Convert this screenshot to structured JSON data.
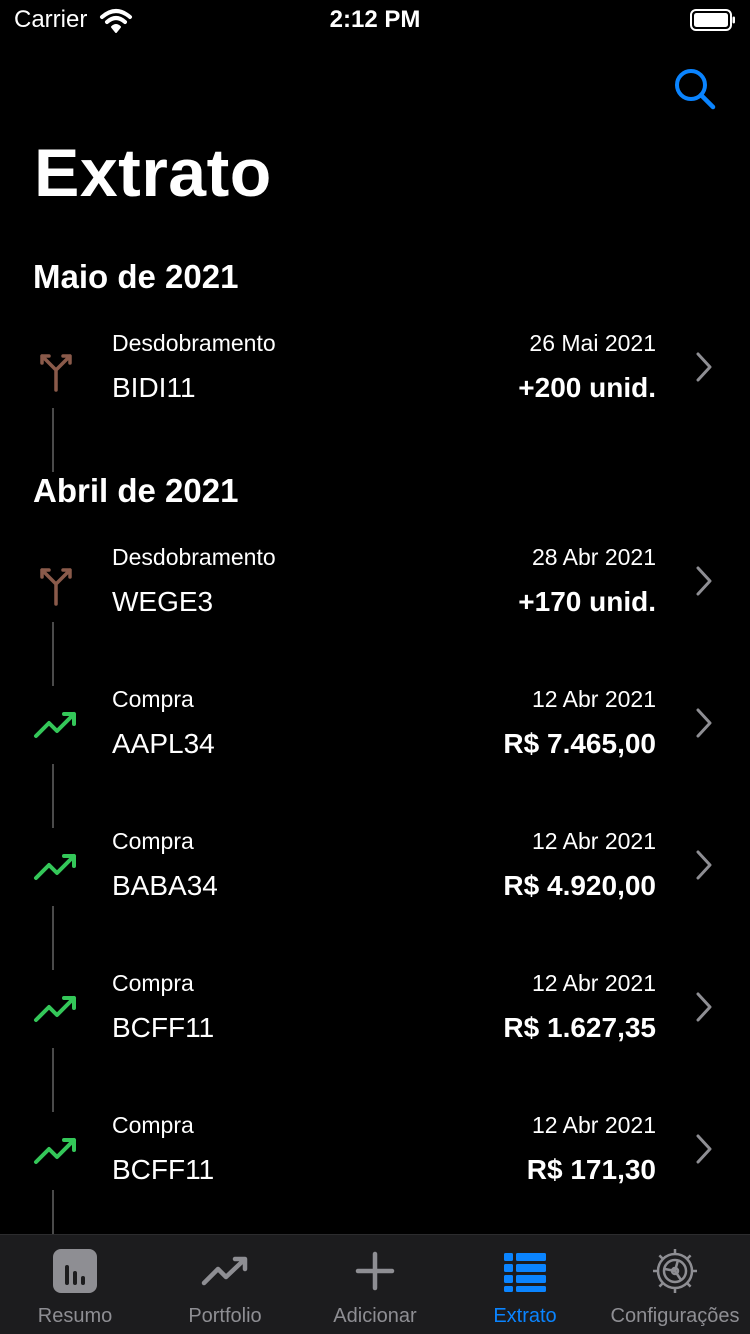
{
  "status_bar": {
    "carrier": "Carrier",
    "time": "2:12 PM"
  },
  "nav": {
    "title": "Extrato",
    "search_icon": "search-icon"
  },
  "colors": {
    "accent": "#0a84ff",
    "split": "#8a5a4a",
    "buy": "#34c759",
    "inactive": "#8e8e93",
    "tab_bar_bg": "#1c1c1e"
  },
  "sections": [
    {
      "header": "Maio de 2021",
      "items": [
        {
          "icon": "split-arrow-icon",
          "type": "Desdobramento",
          "ticker": "BIDI11",
          "date": "26 Mai 2021",
          "amount": "+200 unid."
        }
      ]
    },
    {
      "header": "Abril de 2021",
      "items": [
        {
          "icon": "split-arrow-icon",
          "type": "Desdobramento",
          "ticker": "WEGE3",
          "date": "28 Abr 2021",
          "amount": "+170 unid."
        },
        {
          "icon": "trend-up-icon",
          "type": "Compra",
          "ticker": "AAPL34",
          "date": "12 Abr 2021",
          "amount": "R$ 7.465,00"
        },
        {
          "icon": "trend-up-icon",
          "type": "Compra",
          "ticker": "BABA34",
          "date": "12 Abr 2021",
          "amount": "R$ 4.920,00"
        },
        {
          "icon": "trend-up-icon",
          "type": "Compra",
          "ticker": "BCFF11",
          "date": "12 Abr 2021",
          "amount": "R$ 1.627,35"
        },
        {
          "icon": "trend-up-icon",
          "type": "Compra",
          "ticker": "BCFF11",
          "date": "12 Abr 2021",
          "amount": "R$ 171,30"
        }
      ]
    }
  ],
  "tabs": [
    {
      "label": "Resumo",
      "icon": "bar-chart-icon",
      "active": false
    },
    {
      "label": "Portfolio",
      "icon": "trend-up-icon",
      "active": false
    },
    {
      "label": "Adicionar",
      "icon": "plus-icon",
      "active": false
    },
    {
      "label": "Extrato",
      "icon": "list-icon",
      "active": true
    },
    {
      "label": "Configurações",
      "icon": "gear-icon",
      "active": false
    }
  ]
}
